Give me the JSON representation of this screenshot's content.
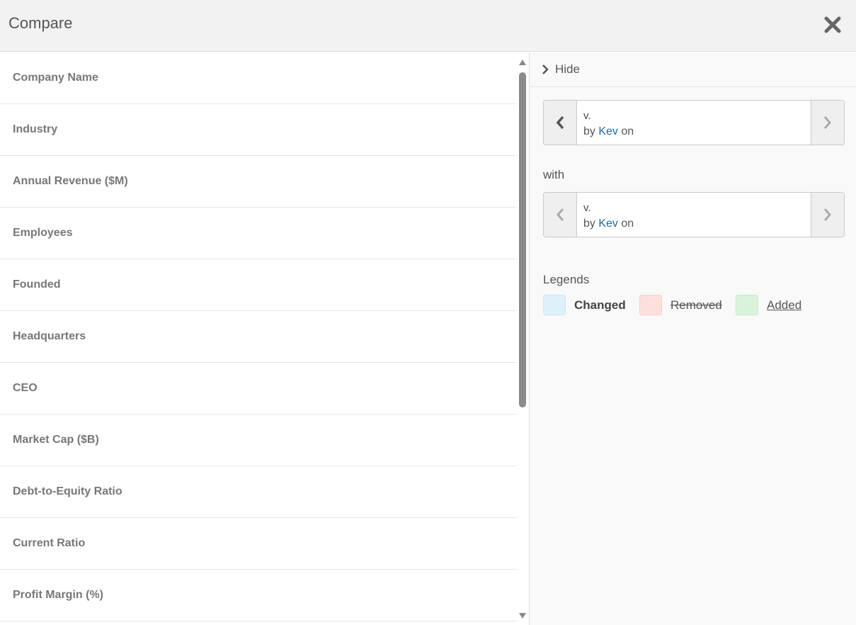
{
  "dialog": {
    "title": "Compare",
    "close_icon": "close-icon"
  },
  "fields": [
    "Company Name",
    "Industry",
    "Annual Revenue ($M)",
    "Employees",
    "Founded",
    "Headquarters",
    "CEO",
    "Market Cap ($B)",
    "Debt-to-Equity Ratio",
    "Current Ratio",
    "Profit Margin (%)"
  ],
  "sidebar": {
    "hide_label": "Hide",
    "from_version": {
      "version": "v.",
      "by": "by",
      "author": "Kev",
      "on": "on"
    },
    "with_label": "with",
    "to_version": {
      "version": "v.",
      "by": "by",
      "author": "Kev",
      "on": "on"
    },
    "legends_label": "Legends",
    "legends": [
      {
        "label": "Changed",
        "color": "#def1fb",
        "style": "bold"
      },
      {
        "label": "Removed",
        "color": "#fde0de",
        "style": "strikethrough"
      },
      {
        "label": "Added",
        "color": "#d9f2da",
        "style": "underline"
      }
    ]
  },
  "colors": {
    "author_link": "#1a6aa8",
    "header_bg": "#f2f2f2"
  }
}
